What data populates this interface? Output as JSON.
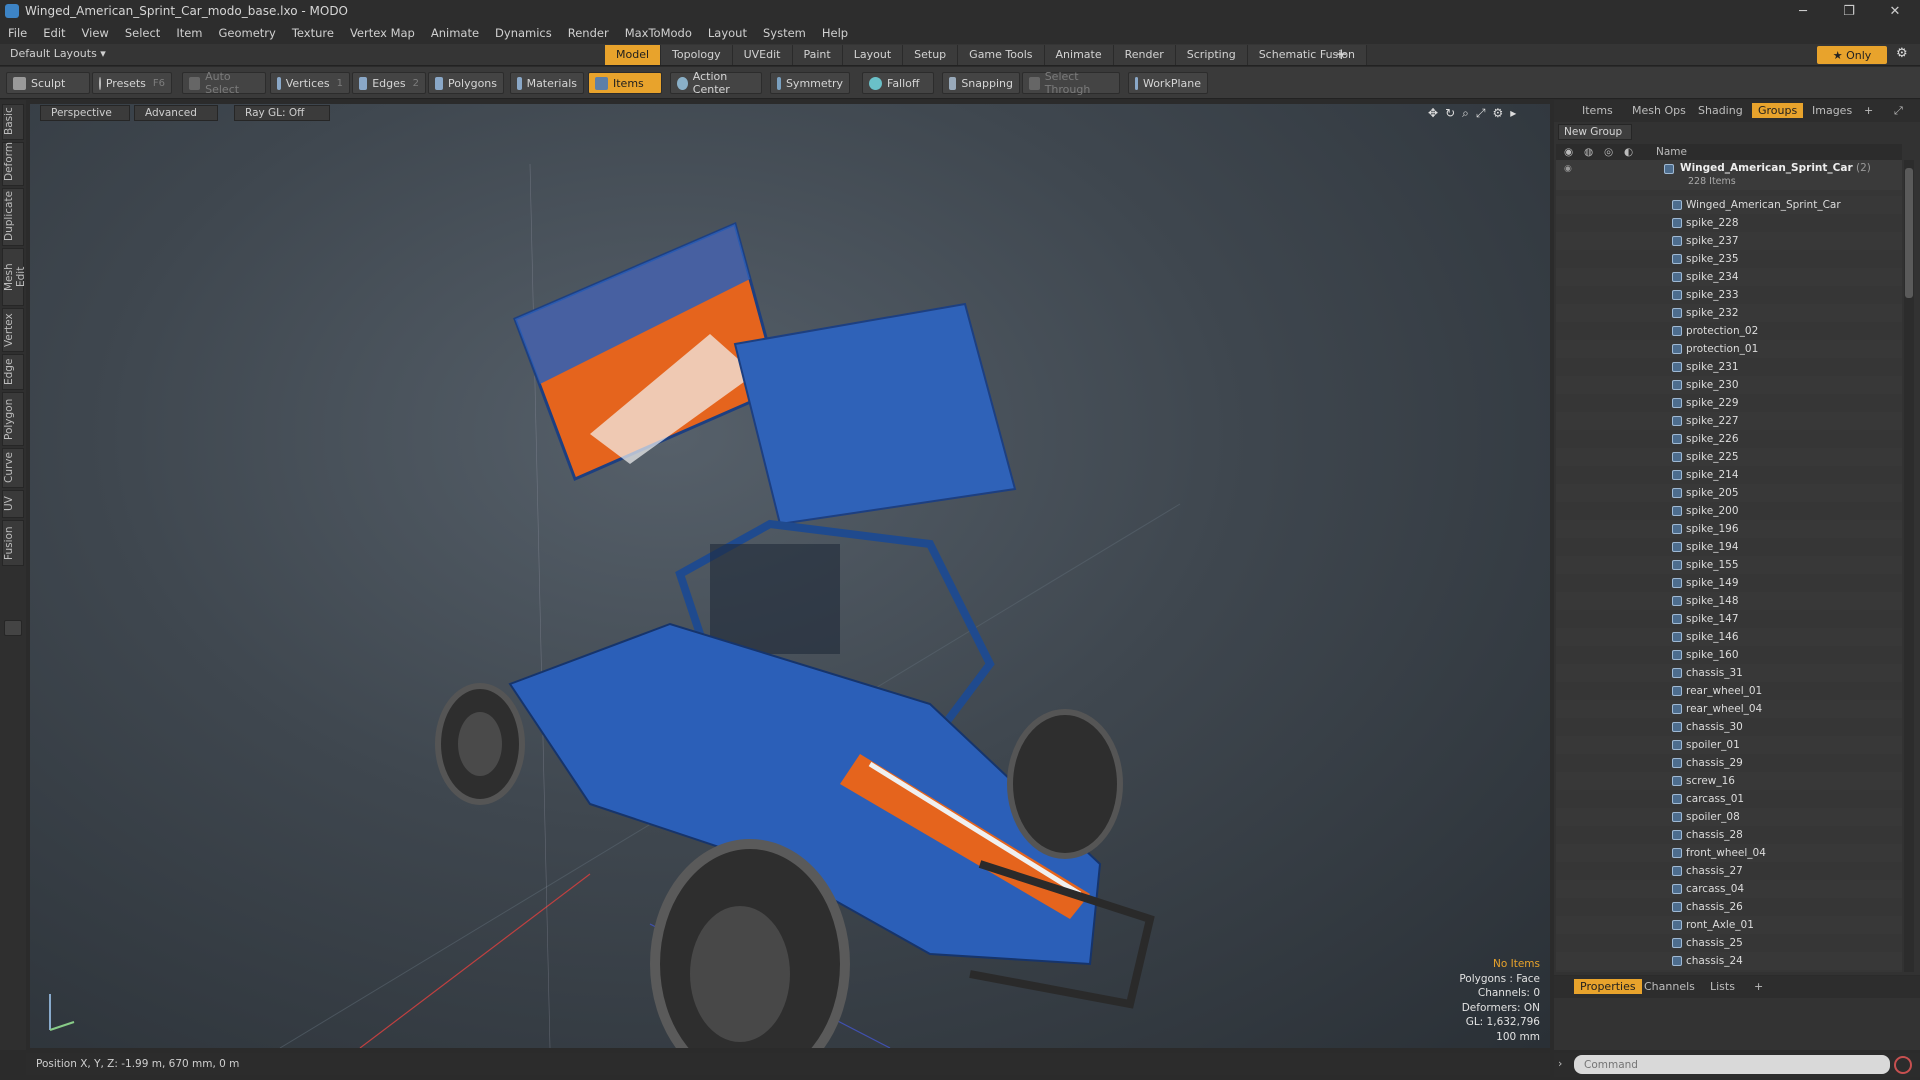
{
  "window": {
    "title": "Winged_American_Sprint_Car_modo_base.lxo - MODO",
    "minimize": "─",
    "maximize": "❐",
    "close": "✕"
  },
  "menu": [
    "File",
    "Edit",
    "View",
    "Select",
    "Item",
    "Geometry",
    "Texture",
    "Vertex Map",
    "Animate",
    "Dynamics",
    "Render",
    "MaxToModo",
    "Layout",
    "System",
    "Help"
  ],
  "layouts": {
    "label": "Default Layouts ▾"
  },
  "tabs": [
    {
      "label": "Model",
      "active": true
    },
    {
      "label": "Topology"
    },
    {
      "label": "UVEdit"
    },
    {
      "label": "Paint"
    },
    {
      "label": "Layout"
    },
    {
      "label": "Setup"
    },
    {
      "label": "Game Tools"
    },
    {
      "label": "Animate"
    },
    {
      "label": "Render"
    },
    {
      "label": "Scripting"
    },
    {
      "label": "Schematic Fusion"
    }
  ],
  "tab_add": "+",
  "only_label": "★ Only",
  "toolbar": {
    "sculpt": "Sculpt",
    "presets": "Presets",
    "presets_key": "F6",
    "auto_select": "Auto Select",
    "vertices": "Vertices",
    "vertices_key": "1",
    "edges": "Edges",
    "edges_key": "2",
    "polygons": "Polygons",
    "materials": "Materials",
    "items": "Items",
    "action_center": "Action Center",
    "symmetry": "Symmetry",
    "falloff": "Falloff",
    "snapping": "Snapping",
    "select_through": "Select Through",
    "workplane": "WorkPlane"
  },
  "left_tabs": [
    "Basic",
    "Deform",
    "Duplicate",
    "Mesh Edit",
    "Vertex",
    "Edge",
    "Polygon",
    "Curve",
    "UV",
    "Fusion"
  ],
  "viewport": {
    "perspective": "Perspective",
    "advanced": "Advanced",
    "raygl": "Ray GL: Off",
    "info": {
      "no_items": "No Items",
      "polygons": "Polygons : Face",
      "channels": "Channels: 0",
      "deformers": "Deformers: ON",
      "gl": "GL: 1,632,796",
      "scale": "100 mm"
    }
  },
  "status": {
    "position": "Position X, Y, Z:  -1.99 m, 670 mm, 0 m"
  },
  "right_tabs": [
    "Items",
    "Mesh Ops",
    "Shading",
    "Groups",
    "Images"
  ],
  "right_tab_active": "Groups",
  "new_group": "New Group",
  "list_header": {
    "name": "Name"
  },
  "group": {
    "name": "Winged_American_Sprint_Car",
    "count": "(2)",
    "items": "228 Items"
  },
  "list_items": [
    "Winged_American_Sprint_Car",
    "spike_228",
    "spike_237",
    "spike_235",
    "spike_234",
    "spike_233",
    "spike_232",
    "protection_02",
    "protection_01",
    "spike_231",
    "spike_230",
    "spike_229",
    "spike_227",
    "spike_226",
    "spike_225",
    "spike_214",
    "spike_205",
    "spike_200",
    "spike_196",
    "spike_194",
    "spike_155",
    "spike_149",
    "spike_148",
    "spike_147",
    "spike_146",
    "spike_160",
    "chassis_31",
    "rear_wheel_01",
    "rear_wheel_04",
    "chassis_30",
    "spoiler_01",
    "chassis_29",
    "screw_16",
    "carcass_01",
    "spoiler_08",
    "chassis_28",
    "front_wheel_04",
    "chassis_27",
    "carcass_04",
    "chassis_26",
    "ront_Axle_01",
    "chassis_25",
    "chassis_24"
  ],
  "bottom_tabs": [
    "Properties",
    "Channels",
    "Lists"
  ],
  "bottom_tab_active": "Properties",
  "command": {
    "placeholder": "Command"
  },
  "colors": {
    "accent": "#e8a32c",
    "car_blue": "#2b5fb8",
    "car_orange": "#e5641d"
  }
}
